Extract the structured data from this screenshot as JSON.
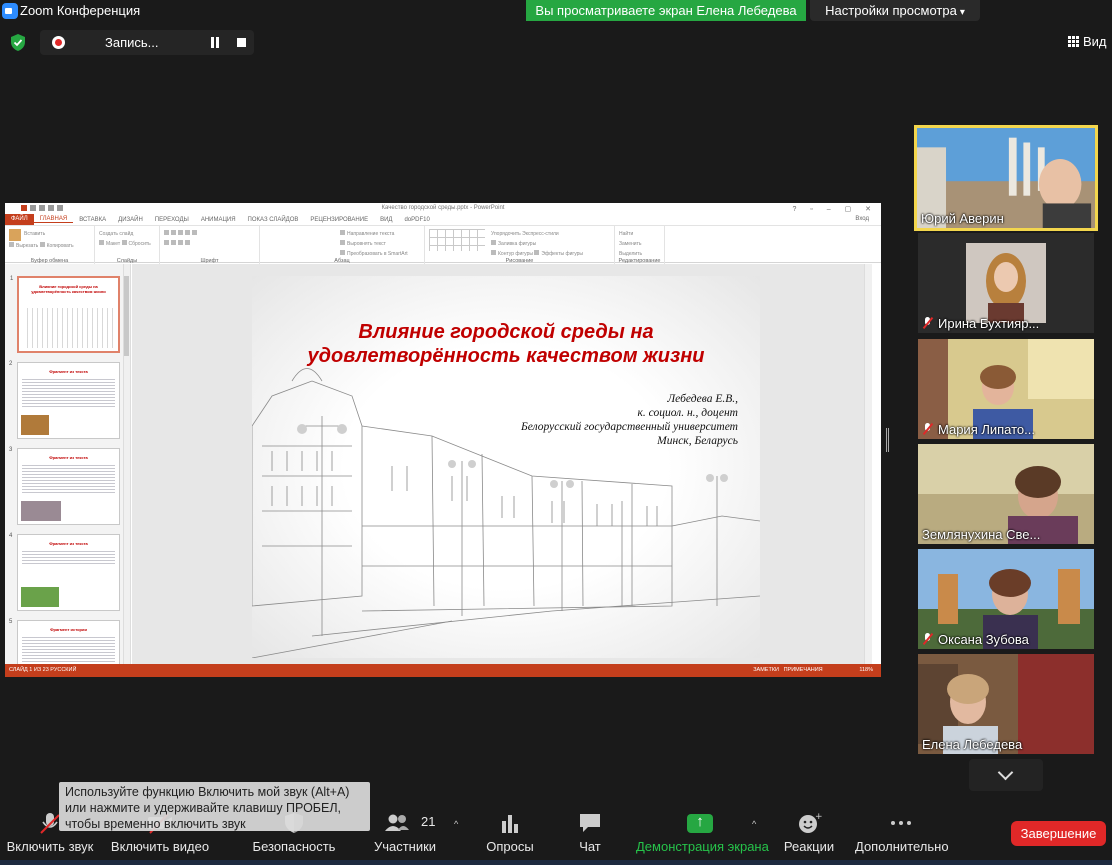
{
  "window": {
    "title": "Zoom Конференция",
    "share_banner": "Вы просматриваете экран Елена Лебедева",
    "view_options": "Настройки просмотра",
    "view_button": "Вид"
  },
  "recording": {
    "label": "Запись..."
  },
  "ppt": {
    "title": "Качество городской среды.pptx - PowerPoint",
    "tabs": [
      "ФАЙЛ",
      "ГЛАВНАЯ",
      "ВСТАВКА",
      "ДИЗАЙН",
      "ПЕРЕХОДЫ",
      "АНИМАЦИЯ",
      "ПОКАЗ СЛАЙДОВ",
      "РЕЦЕНЗИРОВАНИЕ",
      "ВИД",
      "doPDF10"
    ],
    "signin": "Вход",
    "ribbon_groups": [
      {
        "label": "Буфер обмена",
        "items": [
          "Вставить",
          "Вырезать",
          "Копировать",
          "Формат по образцу"
        ]
      },
      {
        "label": "Слайды",
        "items": [
          "Создать слайд",
          "Макет",
          "Сбросить",
          "Раздел"
        ]
      },
      {
        "label": "Шрифт",
        "items": []
      },
      {
        "label": "Абзац",
        "items": [
          "Направление текста",
          "Выровнять текст",
          "Преобразовать в SmartArt"
        ]
      },
      {
        "label": "Рисование",
        "items": [
          "Упорядочить",
          "Экспресс-стили",
          "Заливка фигуры",
          "Контур фигуры",
          "Эффекты фигуры"
        ]
      },
      {
        "label": "Редактирование",
        "items": [
          "Найти",
          "Заменить",
          "Выделить"
        ]
      }
    ],
    "thumbnails": [
      {
        "num": "1",
        "title": "Влияние городской среды на удовлетворённость качеством жизни"
      },
      {
        "num": "2",
        "title": "Фрагмент из текста"
      },
      {
        "num": "3",
        "title": "Фрагмент из текста"
      },
      {
        "num": "4",
        "title": "Фрагмент из текста"
      },
      {
        "num": "5",
        "title": "Фрагмент истории"
      }
    ],
    "slide": {
      "title_line1": "Влияние городской среды на",
      "title_line2": "удовлетворённость качеством жизни",
      "author": "Лебедева Е.В.,",
      "degree": "к. социол. н., доцент",
      "university": "Белорусский государственный университет",
      "city": "Минск, Беларусь"
    },
    "status_left": "СЛАЙД 1 ИЗ 23     РУССКИЙ",
    "status_notes": "ЗАМЕТКИ",
    "status_comments": "ПРИМЕЧАНИЯ",
    "zoom": "118%"
  },
  "participants": [
    {
      "name": "Юрий Аверин",
      "muted": false,
      "active": true
    },
    {
      "name": "Ирина Бухтияр...",
      "muted": true,
      "active": false
    },
    {
      "name": "Мария Липато...",
      "muted": true,
      "active": false
    },
    {
      "name": "Землянухина Све...",
      "muted": false,
      "active": false
    },
    {
      "name": "Оксана Зубова",
      "muted": true,
      "active": false
    },
    {
      "name": "Елена Лебедева",
      "muted": false,
      "active": false
    }
  ],
  "tooltip": "Используйте функцию Включить мой звук (Alt+A) или нажмите и удерживайте клавишу ПРОБЕЛ, чтобы временно включить звук",
  "toolbar": {
    "audio": "Включить звук",
    "video": "Включить видео",
    "security": "Безопасность",
    "participants": "Участники",
    "participants_count": "21",
    "polls": "Опросы",
    "chat": "Чат",
    "share": "Демонстрация экрана",
    "reactions": "Реакции",
    "more": "Дополнительно",
    "end": "Завершение"
  },
  "colors": {
    "share_green": "#26a742",
    "end_red": "#e02828",
    "active_speaker": "#f3d64d",
    "ppt_accent": "#c43e1c",
    "slide_title": "#c00000"
  }
}
